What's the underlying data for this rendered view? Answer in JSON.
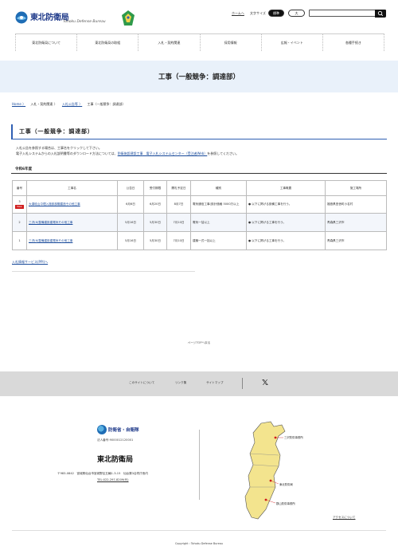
{
  "header": {
    "logo_title": "東北防衛局",
    "logo_sub": "Tohoku Defense Bureau",
    "util_home": "ホームへ",
    "font_size_label": "文字サイズ",
    "font_std": "標準",
    "font_large": "大",
    "search_placeholder": ""
  },
  "gnav": {
    "items": [
      {
        "label": "東北防衛局について"
      },
      {
        "label": "東北防衛局の取組"
      },
      {
        "label": "入札・契約関連"
      },
      {
        "label": "採用情報"
      },
      {
        "label": "広報・イベント"
      },
      {
        "label": "各種手続き"
      }
    ]
  },
  "hero": {
    "title": "工事（一般競争：調達部）"
  },
  "breadcrumb": {
    "items": [
      {
        "label": "Home 〉"
      },
      {
        "label": "入札・契約関連 〉"
      },
      {
        "label": "入札公告等 〉"
      },
      {
        "label": "工事（一般競争：調達部）"
      }
    ]
  },
  "section": {
    "title": "工事（一般競争：調達部）",
    "intro_line1": "入札公告を参照する場合は、工事名をクリックして下さい。",
    "intro_line2_a": "電子入札システムからの入札説明書等のダウンロード方法については、",
    "intro_line2_link": "防衛施設建設工事　電子入札システムセンター（受注者Web）",
    "intro_line2_b": "を参照してください。",
    "year": "令和6年度"
  },
  "table": {
    "headers": {
      "no": "番号",
      "name": "工事名",
      "notice": "公告日",
      "deadline": "受付期限",
      "opening": "開札予定日",
      "category": "種別",
      "summary": "工事概要",
      "place": "施工場所"
    },
    "rows": [
      {
        "no": "3",
        "badge": "New",
        "name": "大湊岐山中理入施設部棚建造その他工事",
        "notice": "6月6日",
        "deadline": "6月20日",
        "opening": "8月7日",
        "category": "電気通信工事(設計価格 5000万以上",
        "summary": "● 以下に掲げる設備工事を行う。",
        "place": "福島県田舎町小名村"
      },
      {
        "no": "2",
        "badge": "",
        "name": "三沢(6)整備建設建電気その他工事",
        "notice": "5月16日",
        "deadline": "5月30日",
        "opening": "7月10日",
        "category": "電気一括以上",
        "summary": "● 以下に掲げる工事を行う。",
        "place": "青森県三沢市"
      },
      {
        "no": "1",
        "badge": "",
        "name": "三沢(6)整備建設建電気その他工事",
        "notice": "5月16日",
        "deadline": "5月30日",
        "opening": "7月10日",
        "category": "建築一式一括以上",
        "summary": "● 以下に掲げる工事を行う。",
        "place": "青森県三沢市"
      }
    ]
  },
  "bid_link": "入札情報サービス(PPI)へ",
  "pagetop": "ページTOPへ戻る",
  "footer_links": {
    "site": "このサイトについて",
    "links": "リンク集",
    "sitemap": "サイトマップ"
  },
  "footer": {
    "logo_text": "防衛省・自衛隊",
    "corp_no": "法人番号:9000012120001",
    "name": "東北防衛局",
    "address": "〒983-0842　宮城県仙台市宮城野区五輪1-3-15　仙台第3合同庁舎内",
    "tel": "TEL:022-297-8209(代)",
    "map_labels": [
      "三沢防衛事務所",
      "東北防衛局",
      "郡山防衛事務所"
    ],
    "access": "アクセスについて",
    "copyright": "Copyright : Tohoku Defense Bureau"
  },
  "colors": {
    "accent": "#2f5fb3",
    "brand": "#1f3a8a",
    "new_badge": "#d01c1c",
    "hero_bg": "#e9f1fa",
    "footer_band": "#d9d9d9"
  }
}
